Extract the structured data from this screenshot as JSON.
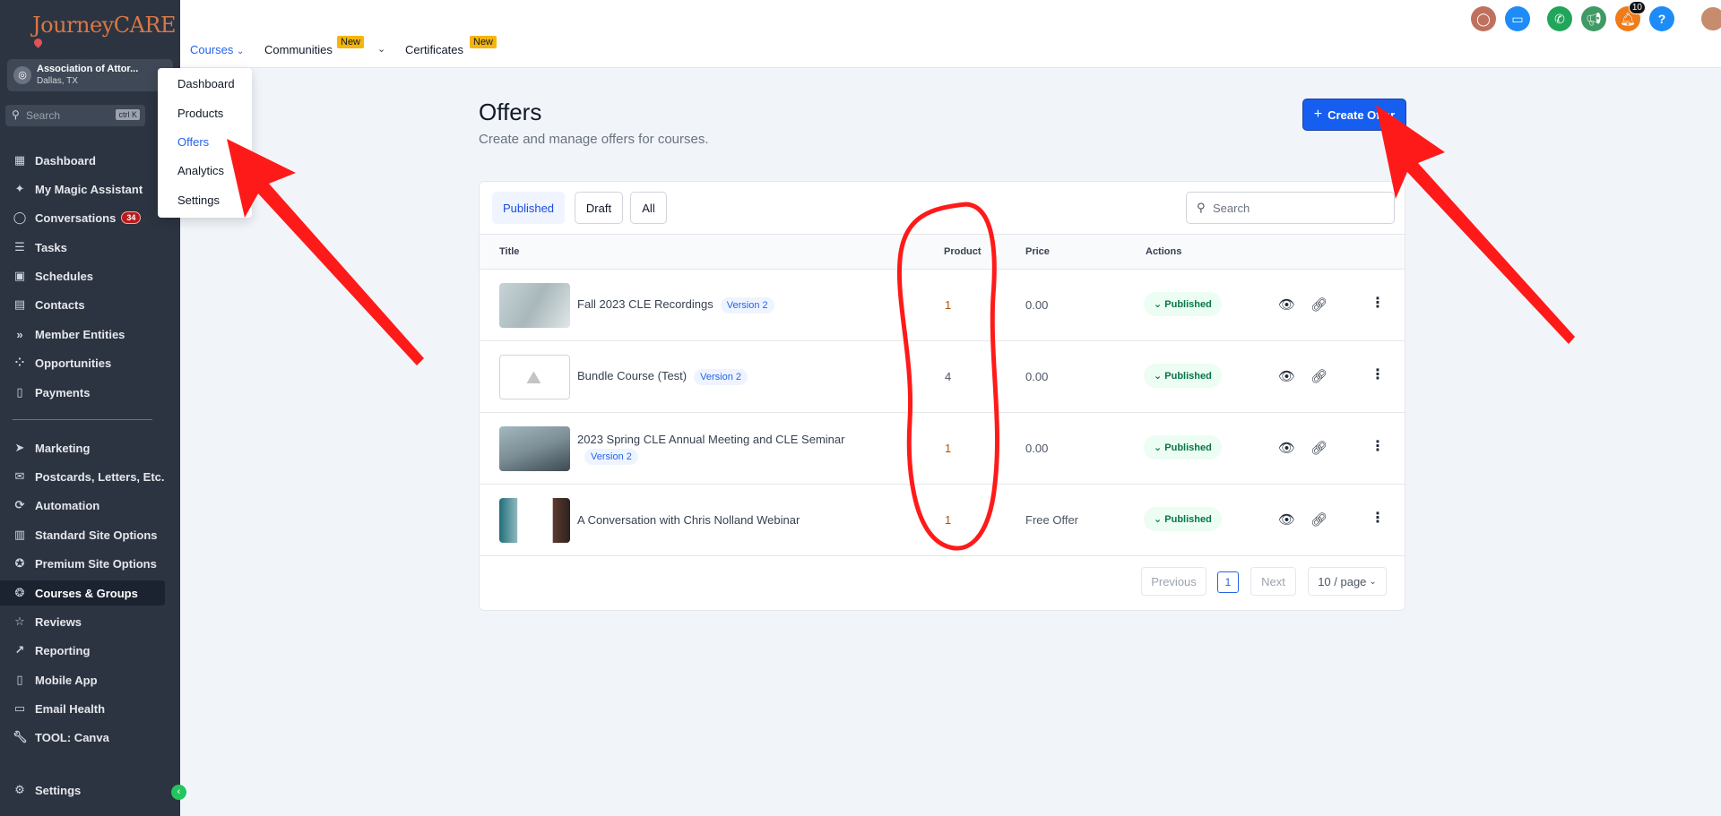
{
  "app": {
    "logo_text": "JourneyCARE"
  },
  "account": {
    "name": "Association of Attor...",
    "location": "Dallas, TX"
  },
  "sidebar_search": {
    "placeholder": "Search",
    "shortcut": "ctrl K"
  },
  "sidebar": {
    "items": [
      {
        "label": "Dashboard",
        "icon": "grid-icon"
      },
      {
        "label": "My Magic Assistant",
        "icon": "magic-wand-icon"
      },
      {
        "label": "Conversations",
        "icon": "chat-icon",
        "badge": "34"
      },
      {
        "label": "Tasks",
        "icon": "list-icon"
      },
      {
        "label": "Schedules",
        "icon": "calendar-icon"
      },
      {
        "label": "Contacts",
        "icon": "contacts-icon"
      },
      {
        "label": "Member Entities",
        "icon": "chevrons-icon"
      },
      {
        "label": "Opportunities",
        "icon": "network-icon"
      },
      {
        "label": "Payments",
        "icon": "receipt-icon"
      },
      {
        "label": "Marketing",
        "icon": "send-icon"
      },
      {
        "label": "Postcards, Letters, Etc.",
        "icon": "mail-icon"
      },
      {
        "label": "Automation",
        "icon": "automation-icon"
      },
      {
        "label": "Standard Site Options",
        "icon": "site-icon"
      },
      {
        "label": "Premium Site Options",
        "icon": "award-icon"
      },
      {
        "label": "Courses & Groups",
        "icon": "ribbon-icon"
      },
      {
        "label": "Reviews",
        "icon": "star-icon"
      },
      {
        "label": "Reporting",
        "icon": "trend-icon"
      },
      {
        "label": "Mobile App",
        "icon": "phone-icon"
      },
      {
        "label": "Email Health",
        "icon": "email-health-icon"
      },
      {
        "label": "TOOL: Canva",
        "icon": "wrench-icon"
      }
    ],
    "settings_label": "Settings"
  },
  "topnav": {
    "tabs": [
      {
        "label": "Courses"
      },
      {
        "label": "Communities",
        "badge": "New"
      },
      {
        "label": "Certificates",
        "badge": "New"
      }
    ],
    "notification_count": "10"
  },
  "dropdown": {
    "items": [
      "Dashboard",
      "Products",
      "Offers",
      "Analytics",
      "Settings"
    ]
  },
  "page": {
    "title": "Offers",
    "subtitle": "Create and manage offers for courses.",
    "create_label": "Create Offer"
  },
  "filters": [
    "Published",
    "Draft",
    "All"
  ],
  "table_search": {
    "placeholder": "Search"
  },
  "table": {
    "headers": {
      "title": "Title",
      "product": "Product",
      "price": "Price",
      "actions": "Actions"
    },
    "rows": [
      {
        "title": "Fall 2023 CLE Recordings",
        "version": "Version 2",
        "product": "1",
        "price": "0.00",
        "status": "Published"
      },
      {
        "title": "Bundle Course (Test)",
        "version": "Version 2",
        "product": "4",
        "price": "0.00",
        "status": "Published"
      },
      {
        "title": "2023 Spring CLE Annual Meeting and CLE Seminar",
        "version": "Version 2",
        "product": "1",
        "price": "0.00",
        "status": "Published"
      },
      {
        "title": "A Conversation with Chris Nolland Webinar",
        "version": "",
        "product": "1",
        "price": "Free Offer",
        "status": "Published"
      }
    ]
  },
  "pagination": {
    "previous": "Previous",
    "page": "1",
    "next": "Next",
    "per_page": "10 / page"
  },
  "colors": {
    "primary": "#155eef",
    "sidebar_bg": "#2c3441",
    "annotation_red": "#ff1a1a"
  }
}
